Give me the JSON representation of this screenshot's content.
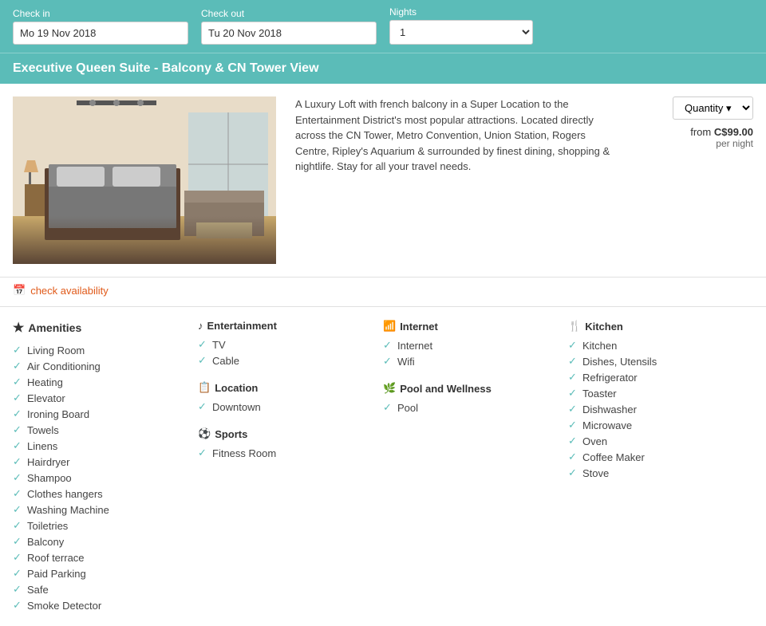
{
  "booking": {
    "checkin_label": "Check in",
    "checkout_label": "Check out",
    "nights_label": "Nights",
    "checkin_value": "Mo 19 Nov 2018",
    "checkout_value": "Tu 20 Nov 2018",
    "nights_value": "1"
  },
  "room": {
    "title": "Executive Queen Suite - Balcony & CN Tower View",
    "description": "A Luxury Loft with french balcony in a Super Location to the Entertainment District's most popular attractions. Located directly across the CN Tower, Metro Convention, Union Station, Rogers Centre, Ripley's Aquarium & surrounded by finest dining, shopping & nightlife. Stay for all your travel needs.",
    "quantity_label": "Quantity",
    "price_from_label": "from C$99.00",
    "price_per_night": "per night",
    "check_avail_label": "check availability"
  },
  "amenities": {
    "section_title": "Amenities",
    "items": [
      "Living Room",
      "Air Conditioning",
      "Heating",
      "Elevator",
      "Ironing Board",
      "Towels",
      "Linens",
      "Hairdryer",
      "Shampoo",
      "Clothes hangers",
      "Washing Machine",
      "Toiletries",
      "Balcony",
      "Roof terrace",
      "Paid Parking",
      "Safe",
      "Smoke Detector"
    ]
  },
  "entertainment": {
    "section_title": "Entertainment",
    "items": [
      "TV",
      "Cable"
    ]
  },
  "location": {
    "section_title": "Location",
    "items": [
      "Downtown"
    ]
  },
  "sports": {
    "section_title": "Sports",
    "items": [
      "Fitness Room"
    ]
  },
  "internet": {
    "section_title": "Internet",
    "items": [
      "Internet",
      "Wifi"
    ]
  },
  "pool": {
    "section_title": "Pool and Wellness",
    "items": [
      "Pool"
    ]
  },
  "kitchen": {
    "section_title": "Kitchen",
    "items": [
      "Kitchen",
      "Dishes, Utensils",
      "Refrigerator",
      "Toaster",
      "Dishwasher",
      "Microwave",
      "Oven",
      "Coffee Maker",
      "Stove"
    ]
  }
}
